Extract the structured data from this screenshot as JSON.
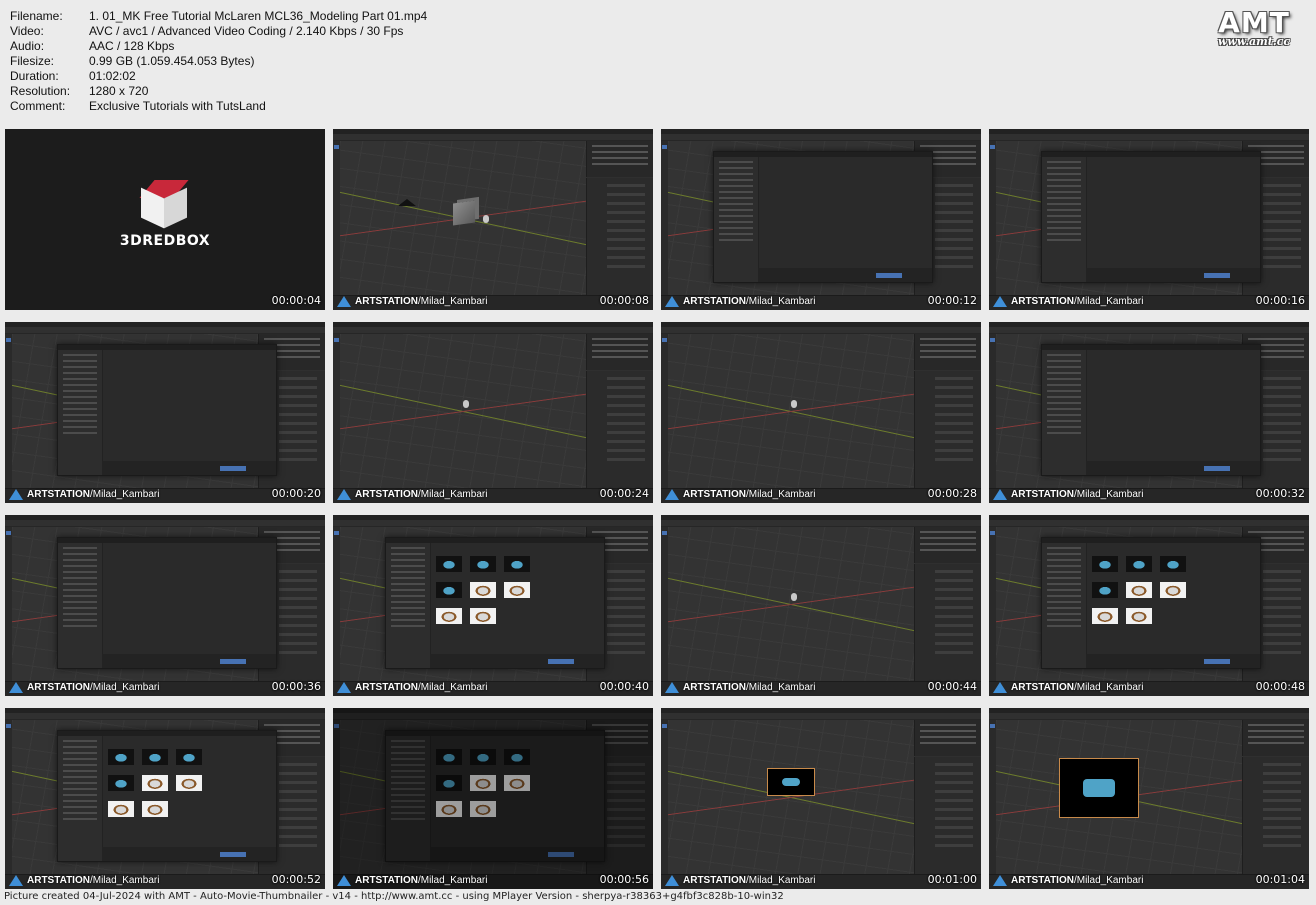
{
  "info": [
    {
      "key": "Filename:",
      "value": "1. 01_MK Free Tutorial McLaren MCL36_Modeling Part 01.mp4"
    },
    {
      "key": "Video:",
      "value": "AVC / avc1 / Advanced Video Coding / 2.140 Kbps / 30 Fps"
    },
    {
      "key": "Audio:",
      "value": "AAC / 128 Kbps"
    },
    {
      "key": "Filesize:",
      "value": "0.99 GB (1.059.454.053 Bytes)"
    },
    {
      "key": "Duration:",
      "value": "01:02:02"
    },
    {
      "key": "Resolution:",
      "value": "1280 x 720"
    },
    {
      "key": "Comment:",
      "value": "Exclusive Tutorials with TutsLand"
    }
  ],
  "logo": {
    "word": "AMT",
    "url": "www.amt.cc"
  },
  "intro_brand": "3DREDBOX",
  "watermark": {
    "prefix": "ARTSTATION",
    "handle": "/Milad_Kambari"
  },
  "thumbnails": [
    {
      "time": "00:00:04",
      "scene": "intro"
    },
    {
      "time": "00:00:08",
      "scene": "viewport-cube"
    },
    {
      "time": "00:00:12",
      "scene": "file-browser"
    },
    {
      "time": "00:00:16",
      "scene": "file-browser"
    },
    {
      "time": "00:00:20",
      "scene": "file-browser"
    },
    {
      "time": "00:00:24",
      "scene": "viewport-empty"
    },
    {
      "time": "00:00:28",
      "scene": "viewport-empty"
    },
    {
      "time": "00:00:32",
      "scene": "file-browser"
    },
    {
      "time": "00:00:36",
      "scene": "file-browser"
    },
    {
      "time": "00:00:40",
      "scene": "file-browser-images"
    },
    {
      "time": "00:00:44",
      "scene": "viewport-empty"
    },
    {
      "time": "00:00:48",
      "scene": "file-browser-images"
    },
    {
      "time": "00:00:52",
      "scene": "file-browser-images"
    },
    {
      "time": "00:00:56",
      "scene": "file-browser-images-dim"
    },
    {
      "time": "00:01:00",
      "scene": "reference-small"
    },
    {
      "time": "00:01:04",
      "scene": "reference-big"
    }
  ],
  "footer": "Picture created 04-Jul-2024 with AMT - Auto-Movie-Thumbnailer - v14 - http://www.amt.cc - using MPlayer Version - sherpya-r38363+g4fbf3c828b-10-win32"
}
